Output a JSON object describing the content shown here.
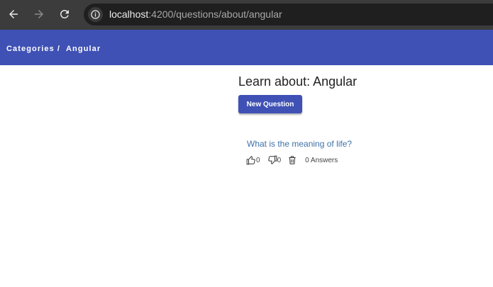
{
  "browser": {
    "url_host": "localhost",
    "url_path": ":4200/questions/about/angular",
    "icons": [
      "back-arrow-icon",
      "forward-arrow-icon",
      "reload-icon",
      "site-info-icon"
    ]
  },
  "toolbar": {
    "breadcrumb": {
      "root": "Categories",
      "separator": "/",
      "current": "Angular"
    },
    "color": "#3f51b5"
  },
  "main": {
    "title": "Learn about: Angular",
    "new_question_label": "New Question",
    "questions": [
      {
        "text": "What is the meaning of life?",
        "upvotes": "0",
        "downvotes": "0",
        "answers": "0 Answers"
      }
    ]
  }
}
